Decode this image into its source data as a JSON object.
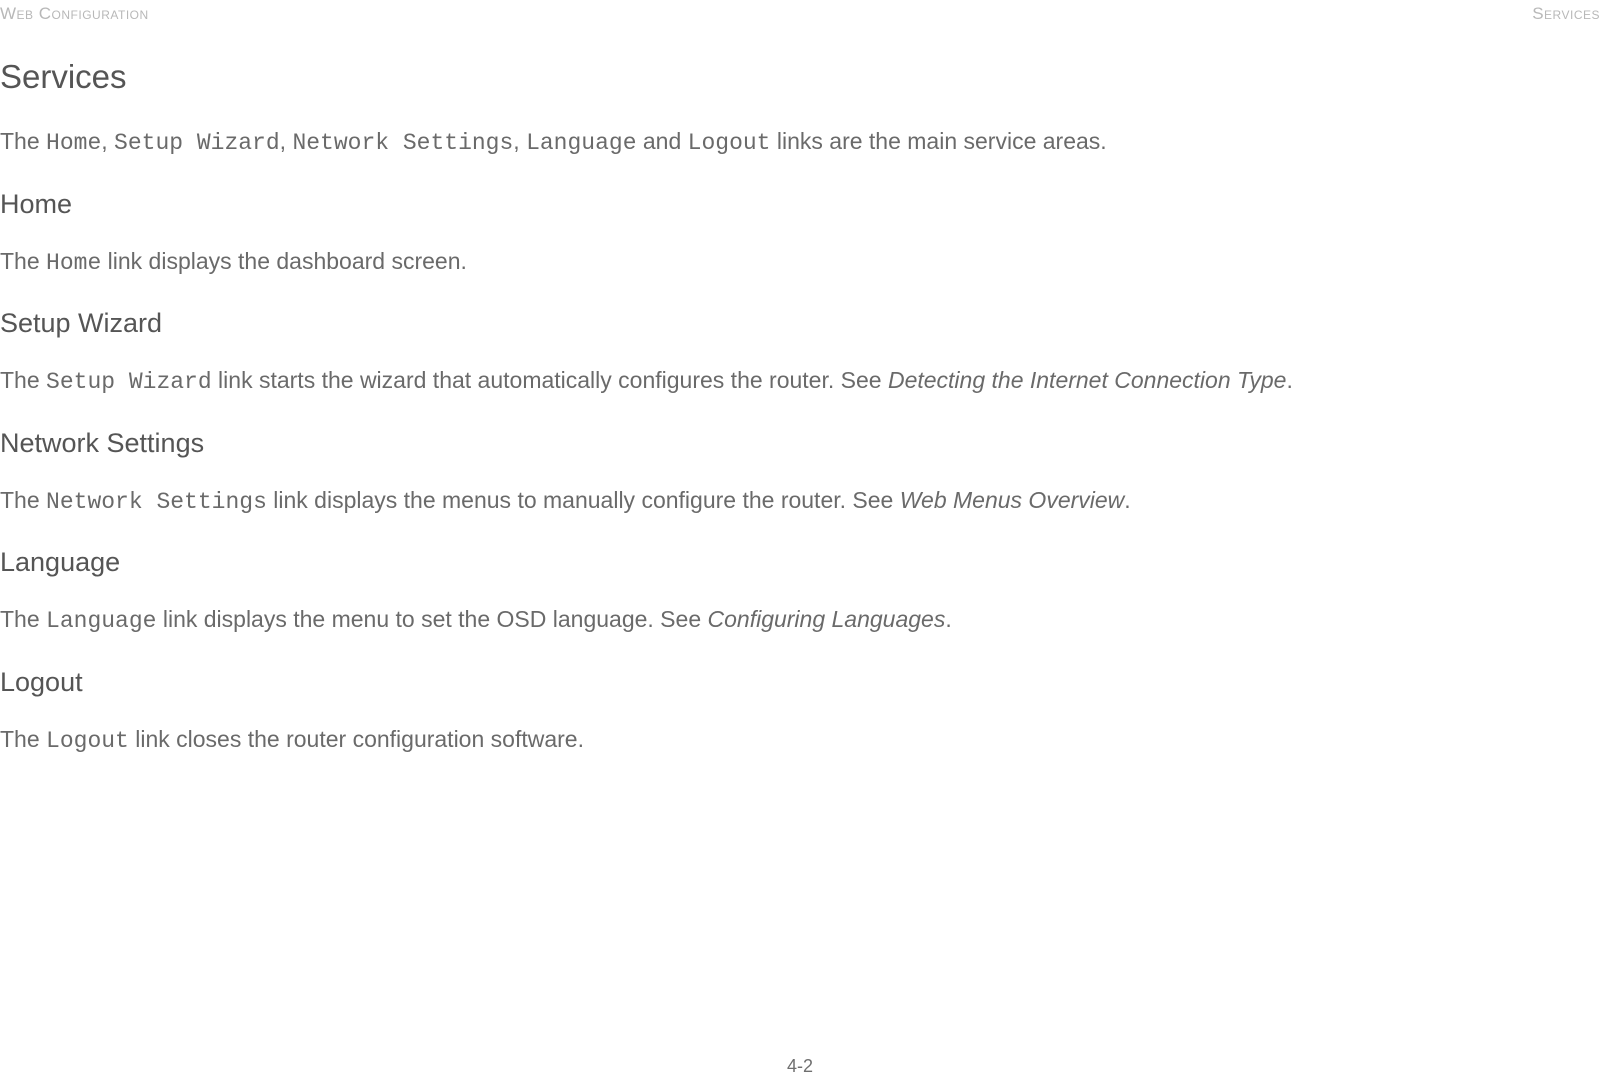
{
  "header": {
    "left": "Web Configuration",
    "right": "Services"
  },
  "title": "Services",
  "intro": {
    "pre": "The ",
    "link1": "Home",
    "sep1": ", ",
    "link2": "Setup Wizard",
    "sep2": ", ",
    "link3": "Network Settings",
    "sep3": ", ",
    "link4": "Language",
    "mid": " and ",
    "link5": "Logout",
    "post": " links are the main service areas."
  },
  "sections": {
    "home": {
      "heading": "Home",
      "pre": "The ",
      "link": "Home",
      "post": " link displays the dashboard screen."
    },
    "setup": {
      "heading": "Setup Wizard",
      "pre": "The ",
      "link": "Setup Wizard",
      "mid": " link starts the wizard that automatically configures the router. See ",
      "ref": "Detecting the Internet Connection Type",
      "post": "."
    },
    "network": {
      "heading": "Network Settings",
      "pre": "The ",
      "link": "Network Settings",
      "mid": " link displays the menus to manually configure the router.  See ",
      "ref": "Web Menus Overview",
      "post": "."
    },
    "language": {
      "heading": "Language",
      "pre": "The ",
      "link": "Language",
      "mid": " link displays the menu to set the OSD language. See ",
      "ref": "Configuring Languages",
      "post": "."
    },
    "logout": {
      "heading": "Logout",
      "pre": "The ",
      "link": "Logout",
      "post": " link closes the router configuration software."
    }
  },
  "pageNumber": "4-2"
}
